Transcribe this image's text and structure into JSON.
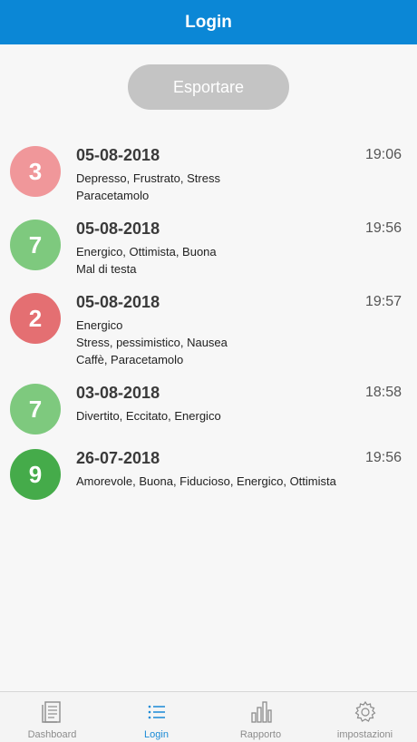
{
  "header": {
    "title": "Login"
  },
  "export_button": {
    "label": "Esportare"
  },
  "entries": [
    {
      "score": "3",
      "color": "#f0979a",
      "date": "05-08-2018",
      "time": "19:06",
      "lines": [
        "Depresso, Frustrato, Stress",
        "Paracetamolo"
      ]
    },
    {
      "score": "7",
      "color": "#7ec97e",
      "date": "05-08-2018",
      "time": "19:56",
      "lines": [
        "Energico, Ottimista, Buona",
        "Mal di testa"
      ]
    },
    {
      "score": "2",
      "color": "#e46f72",
      "date": "05-08-2018",
      "time": "19:57",
      "lines": [
        "Energico",
        "Stress, pessimistico, Nausea",
        "Caffè, Paracetamolo"
      ]
    },
    {
      "score": "7",
      "color": "#7ec97e",
      "date": "03-08-2018",
      "time": "18:58",
      "lines": [
        "Divertito, Eccitato, Energico"
      ]
    },
    {
      "score": "9",
      "color": "#45ab4a",
      "date": "26-07-2018",
      "time": "19:56",
      "lines": [
        "Amorevole, Buona, Fiducioso, Energico, Ottimista"
      ]
    }
  ],
  "nav": {
    "items": [
      {
        "label": "Dashboard",
        "icon": "document-icon",
        "active": false
      },
      {
        "label": "Login",
        "icon": "list-icon",
        "active": true
      },
      {
        "label": "Rapporto",
        "icon": "bar-chart-icon",
        "active": false
      },
      {
        "label": "impostazioni",
        "icon": "gear-icon",
        "active": false
      }
    ]
  }
}
